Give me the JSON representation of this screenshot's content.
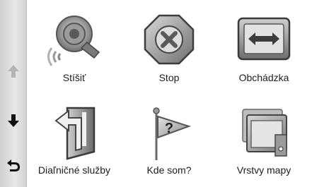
{
  "sidebar": {
    "up": {
      "icon": "arrow-up-icon",
      "enabled": false
    },
    "down": {
      "icon": "arrow-down-icon",
      "enabled": true
    },
    "back": {
      "icon": "back-arrow-icon",
      "enabled": true
    }
  },
  "menu": {
    "items": [
      {
        "label": "Stíšiť",
        "icon": "speaker-icon"
      },
      {
        "label": "Stop",
        "icon": "stop-sign-icon"
      },
      {
        "label": "Obchádzka",
        "icon": "detour-sign-icon"
      },
      {
        "label": "Diaľničné služby",
        "icon": "road-fork-sign-icon"
      },
      {
        "label": "Kde som?",
        "icon": "question-flag-icon"
      },
      {
        "label": "Vrstvy mapy",
        "icon": "map-layers-icon"
      }
    ]
  },
  "colors": {
    "sidebar": "#e0e0e0",
    "disabled_arrow": "#a8a8a8",
    "active_arrow": "#111111"
  }
}
